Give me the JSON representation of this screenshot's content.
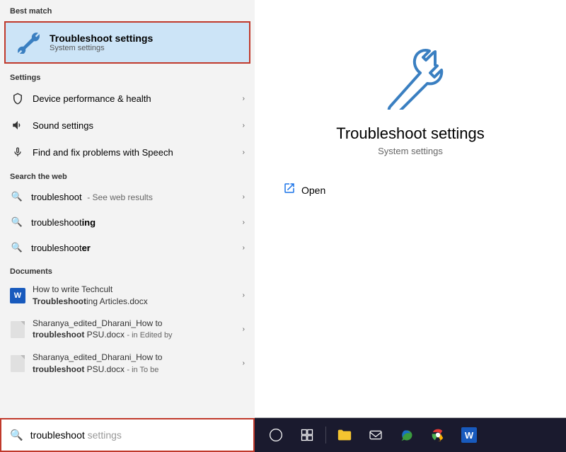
{
  "left": {
    "best_match_label": "Best match",
    "best_match_item": {
      "title": "Troubleshoot settings",
      "subtitle": "System settings"
    },
    "settings_label": "Settings",
    "settings_items": [
      {
        "icon": "shield",
        "label": "Device performance & health"
      },
      {
        "icon": "sound",
        "label": "Sound settings"
      },
      {
        "icon": "mic",
        "label": "Find and fix problems with Speech"
      }
    ],
    "search_web_label": "Search the web",
    "web_items": [
      {
        "typed": "troubleshoot",
        "rest": "",
        "see_results": "- See web results"
      },
      {
        "typed": "troubleshoot",
        "rest": "ing",
        "see_results": ""
      },
      {
        "typed": "troubleshoot",
        "rest": "er",
        "see_results": ""
      }
    ],
    "documents_label": "Documents",
    "doc_items": [
      {
        "type": "word",
        "line1": "How to write Techcult",
        "bold_part": "Troubleshoot",
        "line2_rest": "ing Articles.docx"
      },
      {
        "type": "generic",
        "line1": "Sharanya_edited_Dharani_How to",
        "bold_part": "troubleshoot",
        "line2_rest": " PSU.docx",
        "meta": "- in Edited by"
      },
      {
        "type": "generic",
        "line1": "Sharanya_edited_Dharani_How to",
        "bold_part": "troubleshoot",
        "line2_rest": " PSU.docx",
        "meta": "- in To be"
      }
    ],
    "search_bar": {
      "typed": "troubleshoot",
      "suggestion": " settings"
    }
  },
  "right": {
    "title": "Troubleshoot settings",
    "subtitle": "System settings",
    "open_label": "Open"
  },
  "taskbar": {
    "buttons": [
      {
        "name": "cortana",
        "icon": "○"
      },
      {
        "name": "task-view",
        "icon": "⊡"
      },
      {
        "name": "explorer",
        "icon": "📁"
      },
      {
        "name": "mail",
        "icon": "✉"
      },
      {
        "name": "edge",
        "icon": "e"
      },
      {
        "name": "chrome",
        "icon": "⊕"
      },
      {
        "name": "word",
        "icon": "W"
      }
    ]
  }
}
